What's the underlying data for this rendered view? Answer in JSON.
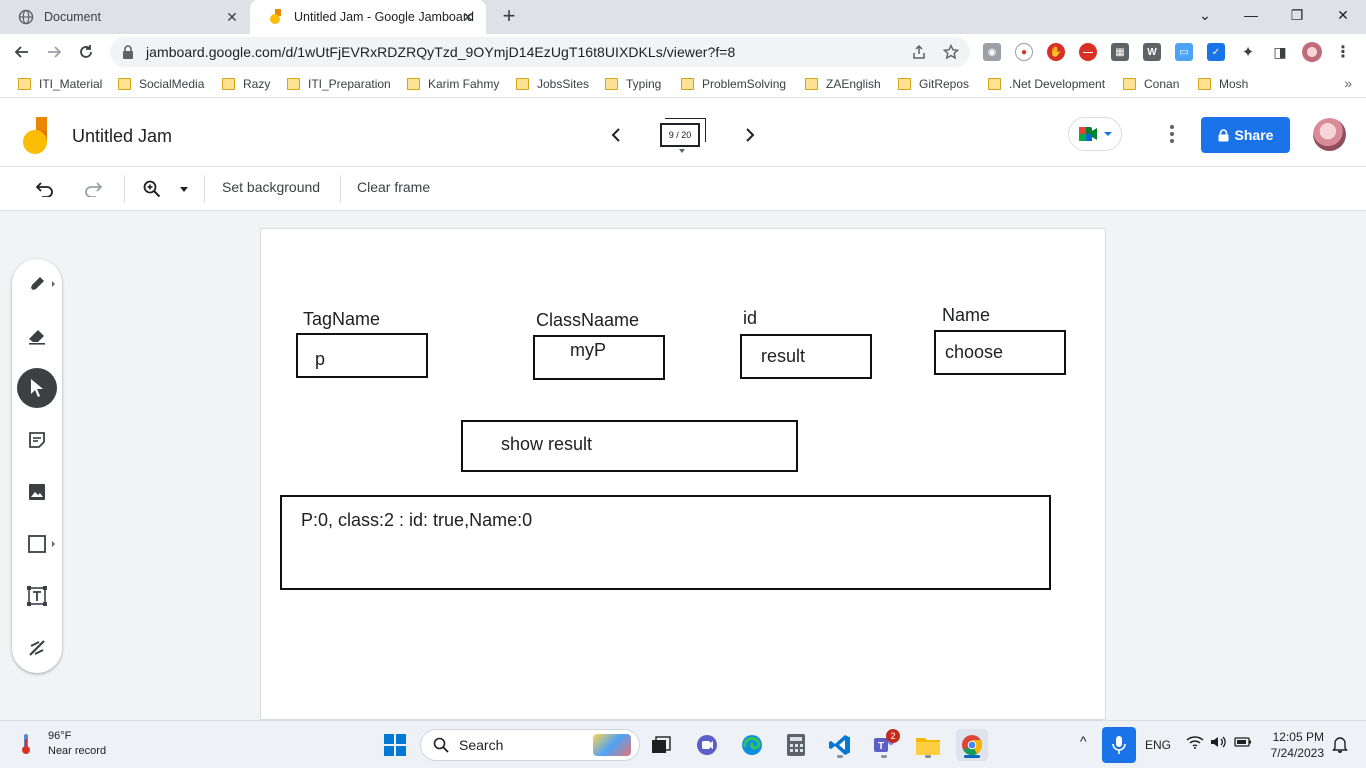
{
  "browser": {
    "tabs": [
      {
        "title": "Document"
      },
      {
        "title": "Untitled Jam - Google Jamboard"
      }
    ],
    "url": "jamboard.google.com/d/1wUtFjEVRxRDZRQyTzd_9OYmjD14EzUgT16t8UIXDKLs/viewer?f=8",
    "bookmarks": [
      "ITI_Material",
      "SocialMedia",
      "Razy",
      "ITI_Preparation",
      "Karim Fahmy",
      "JobsSites",
      "Typing",
      "ProblemSolving",
      "ZAEnglish",
      "GitRepos",
      ".Net Development",
      "Conan",
      "Mosh"
    ]
  },
  "app": {
    "title": "Untitled Jam",
    "frame_indicator": "9 / 20",
    "share_label": "Share"
  },
  "toolbar": {
    "set_background": "Set background",
    "clear_frame": "Clear frame"
  },
  "jam": {
    "labels": {
      "tag_name": "TagName",
      "class_name": "ClassNaame",
      "id": "id",
      "name": "Name"
    },
    "inputs": {
      "tag_value": "p",
      "class_value": "myP",
      "id_value": "result",
      "name_value": "choose"
    },
    "button_label": "show result",
    "output_text": "P:0, class:2 : id: true,Name:0"
  },
  "taskbar": {
    "weather_temp": "96°F",
    "weather_desc": "Near record",
    "search_label": "Search",
    "teams_badge": "2",
    "language": "ENG",
    "time": "12:05 PM",
    "date": "7/24/2023"
  },
  "colors": {
    "share_blue": "#1a73e8",
    "jam_yellow": "#fbbc04",
    "jam_orange": "#ea8600"
  }
}
